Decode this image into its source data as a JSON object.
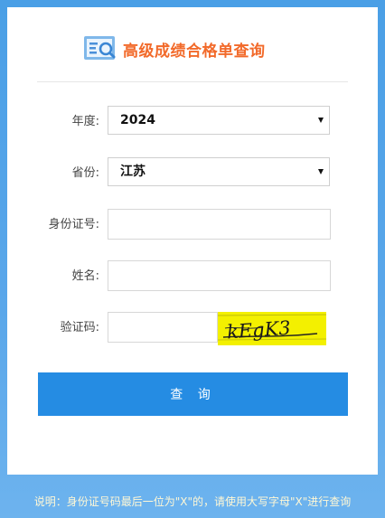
{
  "header": {
    "title": "高级成绩合格单查询",
    "logo_icon": "search-document-icon"
  },
  "form": {
    "year": {
      "label": "年度:",
      "value": "2024"
    },
    "province": {
      "label": "省份:",
      "value": "江苏"
    },
    "id_number": {
      "label": "身份证号:",
      "value": "",
      "placeholder": ""
    },
    "name": {
      "label": "姓名:",
      "value": "",
      "placeholder": ""
    },
    "captcha": {
      "label": "验证码:",
      "value": "",
      "placeholder": "",
      "image_text": "kEgK3"
    },
    "submit_label": "查 询"
  },
  "footer": {
    "note": "说明：身份证号码最后一位为\"X\"的，请使用大写字母\"X\"进行查询"
  },
  "colors": {
    "brand_title": "#f26a2a",
    "button": "#258ce3",
    "background": "#4a9fe6"
  }
}
